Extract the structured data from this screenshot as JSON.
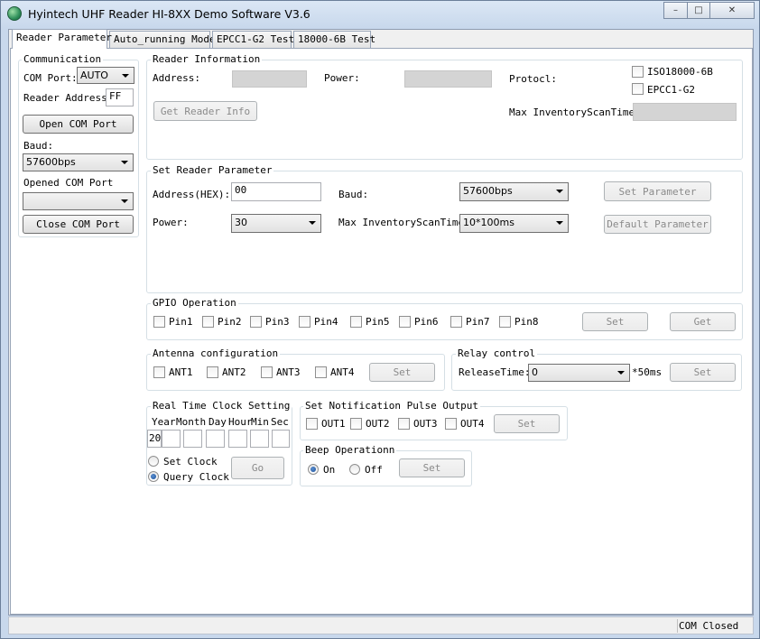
{
  "window": {
    "title": "Hyintech UHF Reader HI-8XX Demo Software V3.6",
    "controls": {
      "minimize": "–",
      "maximize": "□",
      "close": "✕"
    }
  },
  "tabs": [
    {
      "label": "Reader Parameter",
      "active": true
    },
    {
      "label": "Auto_running Mode",
      "active": false
    },
    {
      "label": "EPCC1-G2 Test",
      "active": false
    },
    {
      "label": "18000-6B Test",
      "active": false
    }
  ],
  "communication": {
    "title": "Communication",
    "com_port_label": "COM Port:",
    "com_port_value": "AUTO",
    "reader_address_label": "Reader Address:",
    "reader_address_value": "FF",
    "open_button": "Open COM Port",
    "baud_label": "Baud:",
    "baud_value": "57600bps",
    "opened_label": "Opened COM Port",
    "opened_value": "",
    "close_button": "Close COM Port"
  },
  "reader_info": {
    "title": "Reader Information",
    "address_label": "Address:",
    "power_label": "Power:",
    "protocol_label": "Protocl:",
    "iso_label": "ISO18000-6B",
    "epc_label": "EPCC1-G2",
    "get_button": "Get Reader Info",
    "max_scan_label": "Max InventoryScanTime:"
  },
  "set_param": {
    "title": "Set Reader Parameter",
    "address_label": "Address(HEX):",
    "address_value": "00",
    "baud_label": "Baud:",
    "baud_value": "57600bps",
    "set_button": "Set Parameter",
    "power_label": "Power:",
    "power_value": "30",
    "max_scan_label": "Max InventoryScanTime:",
    "max_scan_value": "10*100ms",
    "default_button": "Default Parameter"
  },
  "gpio": {
    "title": "GPIO Operation",
    "pins": [
      "Pin1",
      "Pin2",
      "Pin3",
      "Pin4",
      "Pin5",
      "Pin6",
      "Pin7",
      "Pin8"
    ],
    "set_button": "Set",
    "get_button": "Get"
  },
  "antenna": {
    "title": "Antenna configuration",
    "items": [
      "ANT1",
      "ANT2",
      "ANT3",
      "ANT4"
    ],
    "set_button": "Set"
  },
  "relay": {
    "title": "Relay control",
    "release_label": "ReleaseTime:",
    "release_value": "0",
    "unit": "*50ms",
    "set_button": "Set"
  },
  "rtc": {
    "title": "Real Time Clock Setting",
    "headers": [
      "Year",
      "Month",
      "Day",
      "Hour",
      "Min",
      "Sec"
    ],
    "year_value": "20",
    "set_clock_label": "Set Clock",
    "query_clock_label": "Query Clock",
    "go_button": "Go"
  },
  "notification": {
    "title": "Set Notification Pulse Output",
    "outputs": [
      "OUT1",
      "OUT2",
      "OUT3",
      "OUT4"
    ],
    "set_button": "Set"
  },
  "beep": {
    "title": "Beep Operationn",
    "on_label": "On",
    "off_label": "Off",
    "set_button": "Set"
  },
  "status": {
    "text": "COM Closed"
  }
}
